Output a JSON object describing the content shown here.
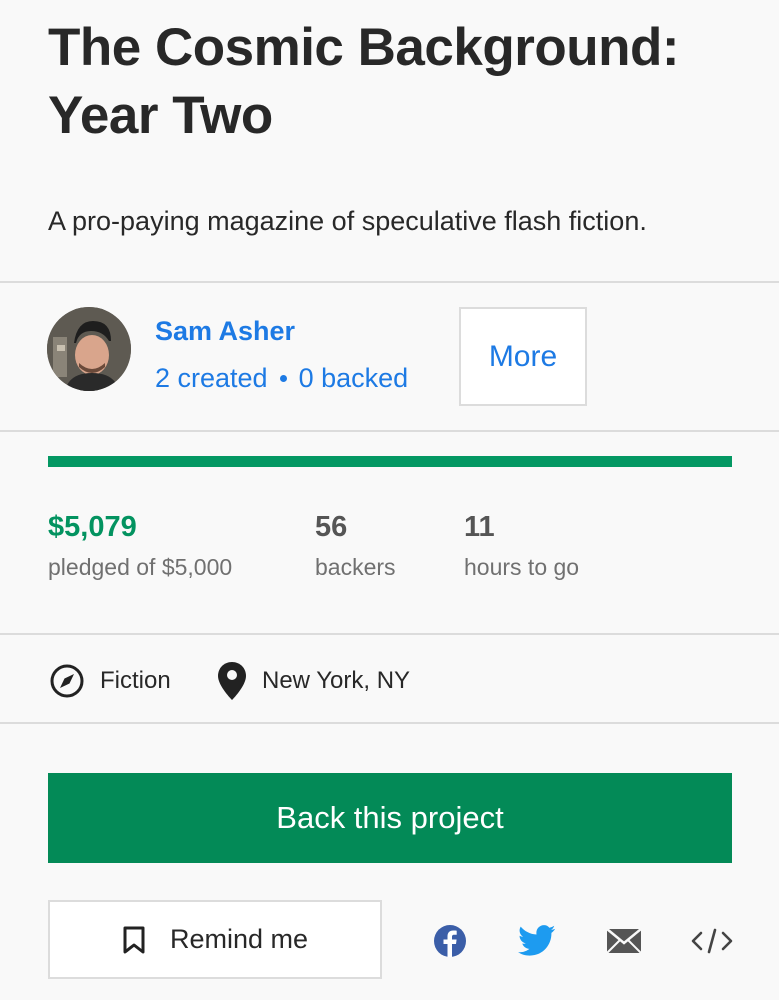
{
  "project": {
    "title": "The Cosmic Background: Year Two",
    "blurb": "A pro-paying magazine of speculative flash fiction."
  },
  "creator": {
    "name": "Sam Asher",
    "created": "2 created",
    "backed": "0 backed",
    "more_label": "More"
  },
  "funding": {
    "progress_fraction": 1.0,
    "pledged": "$5,079",
    "pledged_label": "pledged of $5,000",
    "backers": "56",
    "backers_label": "backers",
    "time_left": "11",
    "time_label": "hours to go"
  },
  "meta": {
    "category": "Fiction",
    "location": "New York, NY"
  },
  "actions": {
    "back_label": "Back this project",
    "remind_label": "Remind me"
  },
  "colors": {
    "accent_green": "#038a57",
    "link_blue": "#1d7ae4"
  },
  "icons": [
    "compass-icon",
    "location-pin-icon",
    "bookmark-icon",
    "facebook-icon",
    "twitter-icon",
    "mail-icon",
    "embed-code-icon"
  ]
}
